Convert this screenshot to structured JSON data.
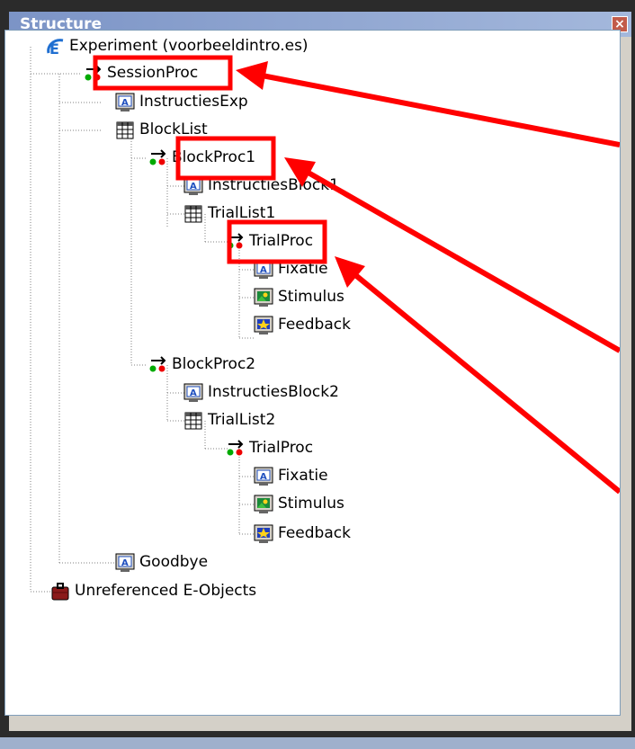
{
  "panel": {
    "title": "Structure",
    "close_icon": "close-icon"
  },
  "tree": {
    "experiment": "Experiment (voorbeeldintro.es)",
    "session_proc": "SessionProc",
    "instructies_exp": "InstructiesExp",
    "block_list": "BlockList",
    "block_proc1": "BlockProc1",
    "instructies_block1": "InstructiesBlock1",
    "trial_list1": "TrialList1",
    "trial_proc1": "TrialProc",
    "fixatie1": "Fixatie",
    "stimulus1": "Stimulus",
    "feedback1": "Feedback",
    "block_proc2": "BlockProc2",
    "instructies_block2": "InstructiesBlock2",
    "trial_list2": "TrialList2",
    "trial_proc2": "TrialProc",
    "fixatie2": "Fixatie",
    "stimulus2": "Stimulus",
    "feedback2": "Feedback",
    "goodbye": "Goodbye",
    "unreferenced": "Unreferenced E-Objects"
  },
  "colors": {
    "highlight": "#ff0000",
    "title_bar": "#7c94c6"
  }
}
